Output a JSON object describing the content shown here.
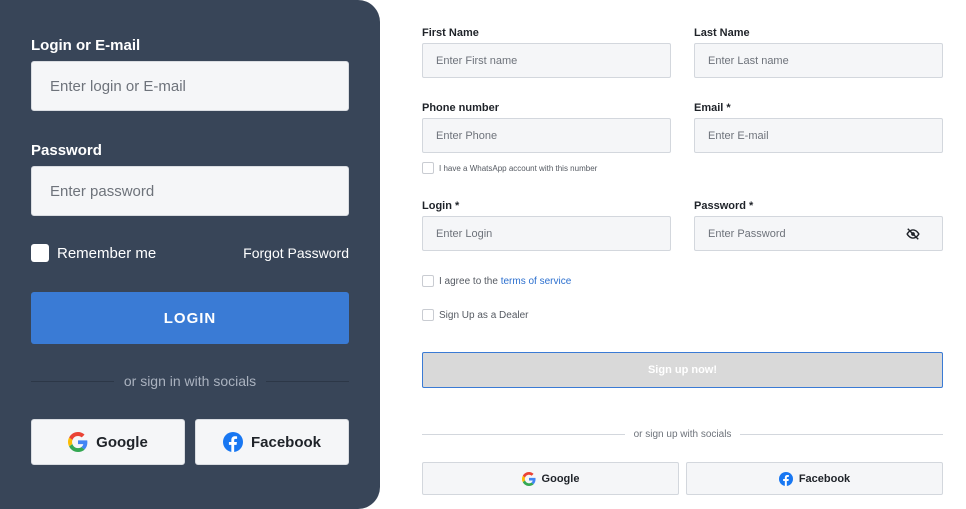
{
  "login_card": {
    "login_label": "Login or E-mail",
    "login_placeholder": "Enter login or E-mail",
    "password_label": "Password",
    "password_placeholder": "Enter password",
    "remember_label": "Remember me",
    "forgot_label": "Forgot Password",
    "login_button": "LOGIN",
    "divider_text": "or sign in with socials",
    "google_label": "Google",
    "facebook_label": "Facebook"
  },
  "signup": {
    "first_name_label": "First Name",
    "first_name_placeholder": "Enter First name",
    "last_name_label": "Last Name",
    "last_name_placeholder": "Enter Last name",
    "phone_label": "Phone number",
    "phone_placeholder": "Enter Phone",
    "email_label": "Email *",
    "email_placeholder": "Enter E-mail",
    "whatsapp_label": "I have a WhatsApp account with this number",
    "login_label": "Login *",
    "login_placeholder": "Enter Login",
    "password_label": "Password *",
    "password_placeholder": "Enter Password",
    "agree_prefix": "I agree to the ",
    "terms_link": "terms of service",
    "dealer_label": "Sign Up as a Dealer",
    "submit_label": "Sign up now!",
    "divider_text": "or sign up with socials",
    "google_label": "Google",
    "facebook_label": "Facebook"
  },
  "colors": {
    "card_bg": "#384558",
    "accent": "#3a7bd5",
    "link": "#2b6fcf",
    "disabled_button": "#d9d9d9"
  },
  "icons": [
    "google-icon",
    "facebook-icon",
    "eye-off-icon"
  ]
}
